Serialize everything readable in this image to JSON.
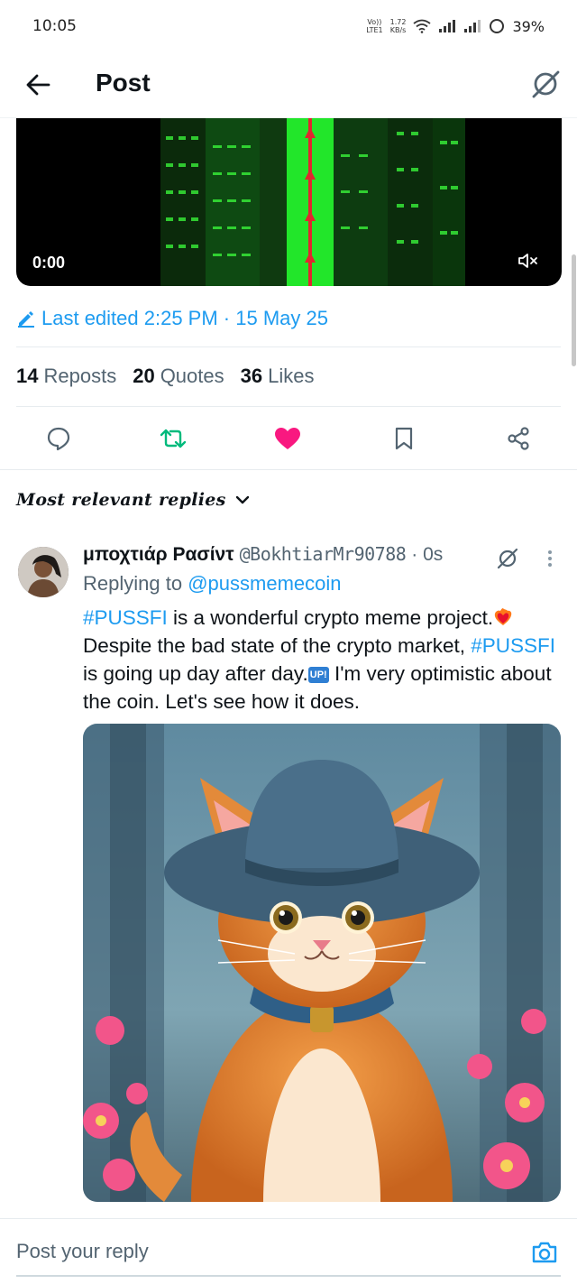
{
  "status_bar": {
    "time": "10:05",
    "volte_top": "Vo))",
    "volte_bottom": "LTE1",
    "speed_top": "1.72",
    "speed_bottom": "KB/s",
    "battery": "39%"
  },
  "header": {
    "title": "Post",
    "back_icon": "arrow-left-icon",
    "grok_icon": "grok-icon"
  },
  "video": {
    "time": "0:00",
    "mute_icon": "volume-muted-icon"
  },
  "post_meta": {
    "edited": "Last edited 2:25 PM · 15 May 25"
  },
  "stats": [
    {
      "count": "14",
      "label": "Reposts"
    },
    {
      "count": "20",
      "label": "Quotes"
    },
    {
      "count": "36",
      "label": "Likes"
    }
  ],
  "actions": {
    "reply_icon": "reply-icon",
    "repost_icon": "repost-icon",
    "like_icon": "heart-icon",
    "bookmark_icon": "bookmark-icon",
    "share_icon": "share-icon",
    "colors": {
      "repost": "#00ba7c",
      "like": "#f91880",
      "link": "#1d9bf0"
    }
  },
  "replies": {
    "sort_label": "Most relevant replies",
    "items": [
      {
        "name": "μποχτιάρ Ρασίντ",
        "handle": "@BokhtiarMr90788",
        "time": "· 0s",
        "replying_prefix": "Replying to",
        "replying_to": "@pussmemecoin",
        "body": {
          "tag1": "#PUSSFI",
          "text1": " is a wonderful crypto meme project.",
          "text2": " Despite the bad state of the crypto market, ",
          "tag2": "#PUSSFI",
          "text3": " is going up day after day.",
          "up_badge": "UP!",
          "text4": " I'm very optimistic about the coin. Let's see how it does."
        }
      }
    ]
  },
  "composer": {
    "placeholder": "Post your reply",
    "camera_icon": "camera-icon"
  }
}
